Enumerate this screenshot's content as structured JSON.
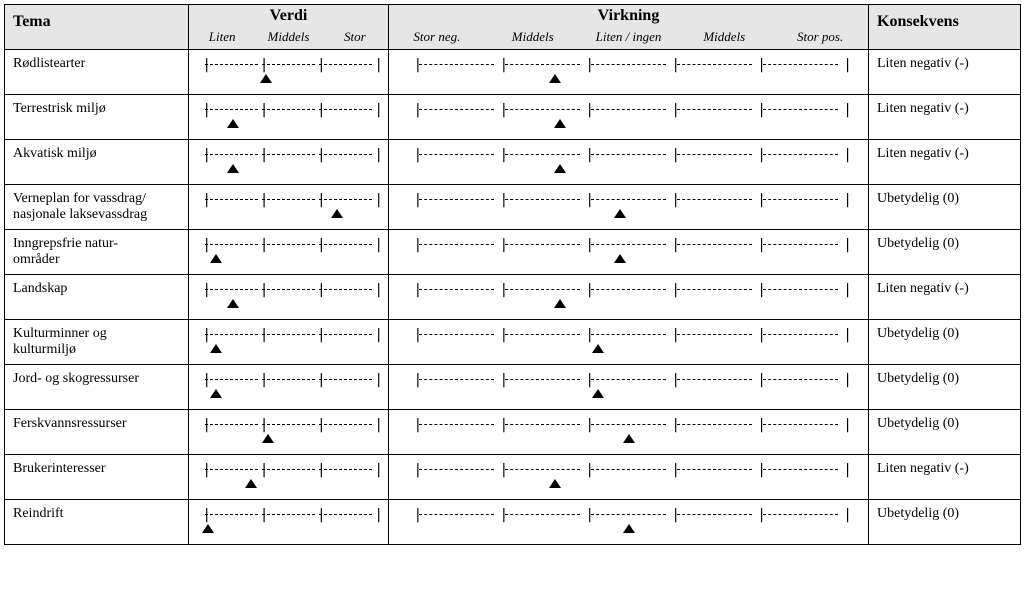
{
  "headers": {
    "tema": "Tema",
    "verdi": "Verdi",
    "virkning": "Virkning",
    "konsekvens": "Konsekvens",
    "verdi_sub": [
      "Liten",
      "Middels",
      "Stor"
    ],
    "virkning_sub": [
      "Stor neg.",
      "Middels",
      "Liten / ingen",
      "Middels",
      "Stor pos."
    ]
  },
  "chart_data": {
    "type": "table",
    "verdi_scale": {
      "segments": 3,
      "labels": [
        "Liten",
        "Middels",
        "Stor"
      ],
      "range_pct": [
        0,
        100
      ]
    },
    "virkning_scale": {
      "segments": 5,
      "labels": [
        "Stor neg.",
        "Middels",
        "Liten / ingen",
        "Middels",
        "Stor pos."
      ],
      "range_pct": [
        0,
        100
      ]
    },
    "rows": [
      {
        "tema": "Rødlistearter",
        "verdi_pct": 37,
        "virkning_pct": 33,
        "konsekvens": "Liten negativ (-)"
      },
      {
        "tema": "Terrestrisk miljø",
        "verdi_pct": 18,
        "virkning_pct": 34,
        "konsekvens": "Liten negativ (-)"
      },
      {
        "tema": "Akvatisk miljø",
        "verdi_pct": 18,
        "virkning_pct": 34,
        "konsekvens": "Liten negativ (-)"
      },
      {
        "tema": "Verneplan for vassdrag/\nnasjonale laksevassdrag",
        "verdi_pct": 78,
        "virkning_pct": 48,
        "konsekvens": "Ubetydelig (0)"
      },
      {
        "tema": "Inngrepsfrie natur-\nområder",
        "verdi_pct": 8,
        "virkning_pct": 48,
        "konsekvens": "Ubetydelig (0)"
      },
      {
        "tema": "Landskap",
        "verdi_pct": 18,
        "virkning_pct": 34,
        "konsekvens": "Liten negativ (-)"
      },
      {
        "tema": "Kulturminner og\nkulturmiljø",
        "verdi_pct": 8,
        "virkning_pct": 43,
        "konsekvens": "Ubetydelig (0)"
      },
      {
        "tema": "Jord- og skogressurser",
        "verdi_pct": 8,
        "virkning_pct": 43,
        "konsekvens": "Ubetydelig (0)"
      },
      {
        "tema": "Ferskvannsressurser",
        "verdi_pct": 38,
        "virkning_pct": 50,
        "konsekvens": "Ubetydelig (0)"
      },
      {
        "tema": "Brukerinteresser",
        "verdi_pct": 28,
        "virkning_pct": 33,
        "konsekvens": "Liten negativ (-)"
      },
      {
        "tema": "Reindrift",
        "verdi_pct": 3,
        "virkning_pct": 50,
        "konsekvens": "Ubetydelig (0)"
      }
    ]
  }
}
